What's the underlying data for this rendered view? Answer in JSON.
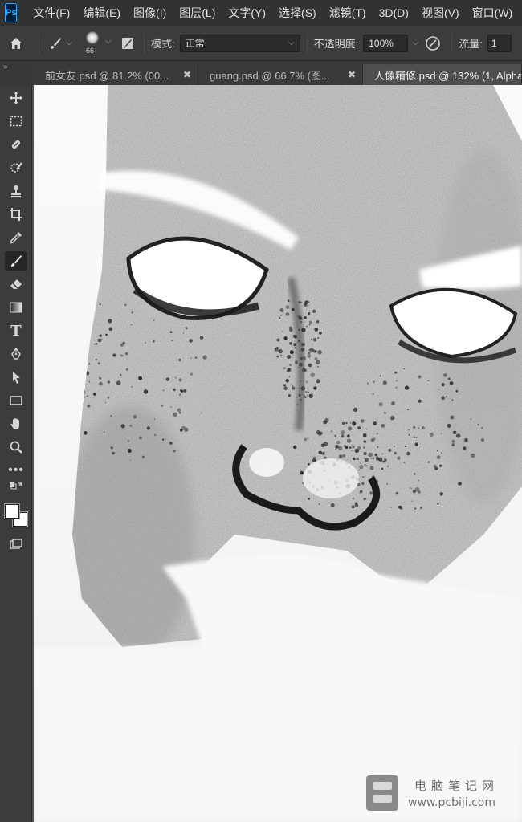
{
  "app": {
    "logo_text": "Ps"
  },
  "menu": [
    "文件(F)",
    "编辑(E)",
    "图像(I)",
    "图层(L)",
    "文字(Y)",
    "选择(S)",
    "滤镜(T)",
    "3D(D)",
    "视图(V)",
    "窗口(W)"
  ],
  "options_bar": {
    "brush_size": "66",
    "mode_label": "模式:",
    "mode_value": "正常",
    "opacity_label": "不透明度:",
    "opacity_value": "100%",
    "flow_label": "流量:",
    "flow_value": "1"
  },
  "tabs": [
    {
      "label": "前女友.psd @ 81.2% (00...",
      "active": false
    },
    {
      "label": "guang.psd @ 66.7% (图...",
      "active": false
    },
    {
      "label": "人像精修.psd @ 132% (1, Alpha",
      "active": true
    }
  ],
  "toolbar": {
    "tools": [
      "move-tool",
      "marquee-tool",
      "healing-tool",
      "quick-selection-tool",
      "clone-stamp-tool",
      "crop-tool",
      "eyedropper-tool",
      "brush-tool",
      "eraser-tool",
      "gradient-tool",
      "type-tool",
      "pen-tool",
      "path-selection-tool",
      "rectangle-tool",
      "hand-tool",
      "zoom-tool",
      "more-tools"
    ],
    "active_tool": "brush-tool",
    "foreground_color": "#ffffff",
    "background_color": "#ffffff"
  },
  "watermark": {
    "title": "电脑笔记网",
    "url": "www.pcbiji.com"
  }
}
